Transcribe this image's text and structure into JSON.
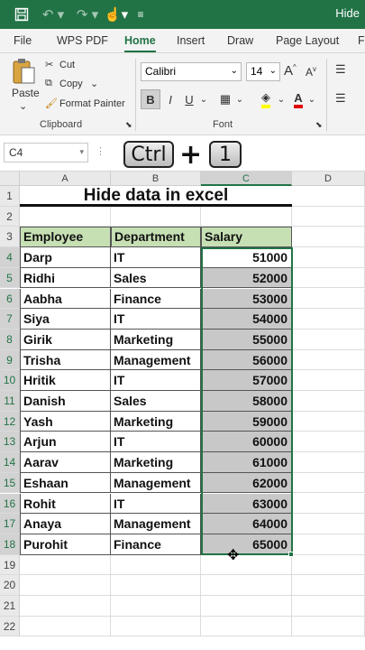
{
  "window": {
    "title": "Hide"
  },
  "quick_access": [
    "save-icon",
    "undo-icon",
    "redo-icon",
    "touch-mode-icon",
    "customize-icon"
  ],
  "tabs": [
    "File",
    "WPS PDF",
    "Home",
    "Insert",
    "Draw",
    "Page Layout",
    "F"
  ],
  "active_tab": "Home",
  "clipboard": {
    "paste": "Paste",
    "cut": "Cut",
    "copy": "Copy",
    "format_painter": "Format Painter",
    "group": "Clipboard"
  },
  "font": {
    "name": "Calibri",
    "size": "14",
    "group": "Font",
    "bold": "B",
    "italic": "I",
    "underline": "U",
    "grow": "A",
    "shrink": "A"
  },
  "namebox": "C4",
  "keys": {
    "ctrl": "Ctrl",
    "plus": "+",
    "one": "1"
  },
  "columns": [
    "A",
    "B",
    "C",
    "D"
  ],
  "rows": [
    "1",
    "2",
    "3",
    "4",
    "5",
    "6",
    "7",
    "8",
    "9",
    "10",
    "11",
    "12",
    "13",
    "14",
    "15",
    "16",
    "17",
    "18",
    "19",
    "20",
    "21",
    "22"
  ],
  "sheet": {
    "title": "Hide data in excel",
    "headers": [
      "Employee",
      "Department",
      "Salary"
    ],
    "data": [
      [
        "Darp",
        "IT",
        "51000"
      ],
      [
        "Ridhi",
        "Sales",
        "52000"
      ],
      [
        "Aabha",
        "Finance",
        "53000"
      ],
      [
        "Siya",
        "IT",
        "54000"
      ],
      [
        "Girik",
        "Marketing",
        "55000"
      ],
      [
        "Trisha",
        "Management",
        "56000"
      ],
      [
        "Hritik",
        "IT",
        "57000"
      ],
      [
        "Danish",
        "Sales",
        "58000"
      ],
      [
        "Yash",
        "Marketing",
        "59000"
      ],
      [
        "Arjun",
        "IT",
        "60000"
      ],
      [
        "Aarav",
        "Marketing",
        "61000"
      ],
      [
        "Eshaan",
        "Management",
        "62000"
      ],
      [
        "Rohit",
        "IT",
        "63000"
      ],
      [
        "Anaya",
        "Management",
        "64000"
      ],
      [
        "Purohit",
        "Finance",
        "65000"
      ]
    ]
  },
  "colors": {
    "accent": "#217346",
    "header_fill": "#c6e0b4",
    "selection": "#c8c8c8"
  }
}
